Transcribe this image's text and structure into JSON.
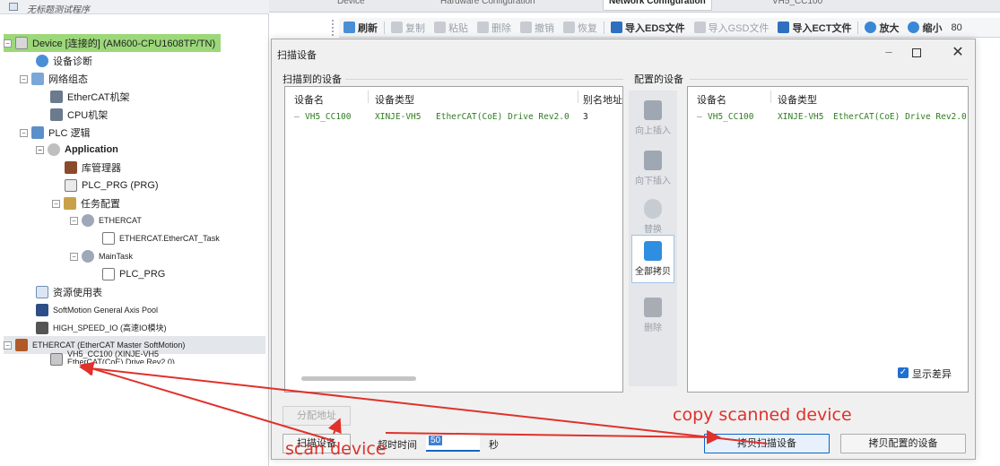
{
  "tabs": [
    "Device",
    "Hardware Configuration",
    "Network Configuration",
    "VH5_CC100"
  ],
  "tree": {
    "title": "无标题测试程序",
    "nodes": [
      {
        "label": "Device [连接的] (AM600-CPU1608TP/TN)"
      },
      {
        "label": "设备诊断"
      },
      {
        "label": "网络组态"
      },
      {
        "label": "EtherCAT机架"
      },
      {
        "label": "CPU机架"
      },
      {
        "label": "PLC 逻辑"
      },
      {
        "label": "Application"
      },
      {
        "label": "库管理器"
      },
      {
        "label": "PLC_PRG (PRG)"
      },
      {
        "label": "任务配置"
      },
      {
        "label": "ETHERCAT"
      },
      {
        "label": "ETHERCAT.EtherCAT_Task"
      },
      {
        "label": "MainTask"
      },
      {
        "label": "PLC_PRG"
      },
      {
        "label": "资源使用表"
      },
      {
        "label": "SoftMotion General Axis Pool"
      },
      {
        "label": "HIGH_SPEED_IO (高速IO模块)"
      },
      {
        "label": "ETHERCAT (EtherCAT Master SoftMotion)"
      },
      {
        "label": "VH5_CC100 (XINJE-VH5"
      },
      {
        "label": "EtherCAT(CoE) Drive Rev2.0)"
      }
    ]
  },
  "toolbar": {
    "refresh": "刷新",
    "copy": "复制",
    "paste": "粘贴",
    "delete": "删除",
    "undo": "撤销",
    "redo": "恢复",
    "import_eds": "导入EDS文件",
    "import_gsd": "导入GSD文件",
    "import_ect": "导入ECT文件",
    "zoom_in": "放大",
    "zoom_out": "缩小",
    "zoom_value": "80"
  },
  "dialog": {
    "title": "扫描设备",
    "scanned_group": "扫描到的设备",
    "configured_group": "配置的设备",
    "scanned_headers": [
      "设备名",
      "设备类型",
      "别名地址"
    ],
    "configured_headers": [
      "设备名",
      "设备类型"
    ],
    "scanned_row": {
      "name": "VH5_CC100",
      "vendor": "XINJE-VH5",
      "type": "EtherCAT(CoE) Drive Rev2.0",
      "alias": "3"
    },
    "configured_row": {
      "name": "VH5_CC100",
      "vendor": "XINJE-VH5",
      "type": "EtherCAT(CoE) Drive Rev2.0"
    },
    "actions": {
      "insert_above": "向上插入",
      "insert_below": "向下插入",
      "replace": "替换",
      "copy_all": "全部拷贝",
      "delete": "删除"
    },
    "assign_address": "分配地址",
    "scan_button": "扫描设备",
    "timeout_label": "超时时间",
    "timeout_value": "50",
    "timeout_unit": "秒",
    "show_diff": "显示差异",
    "copy_scanned": "拷贝扫描设备",
    "copy_configured": "拷贝配置的设备"
  },
  "annotations": {
    "scan": "scan device",
    "copy": "copy scanned device"
  },
  "colors": {
    "annotation": "#e0312b",
    "accent": "#1f6fd1",
    "device_green": "#9cd87a",
    "row_text": "#2e7d1e"
  }
}
